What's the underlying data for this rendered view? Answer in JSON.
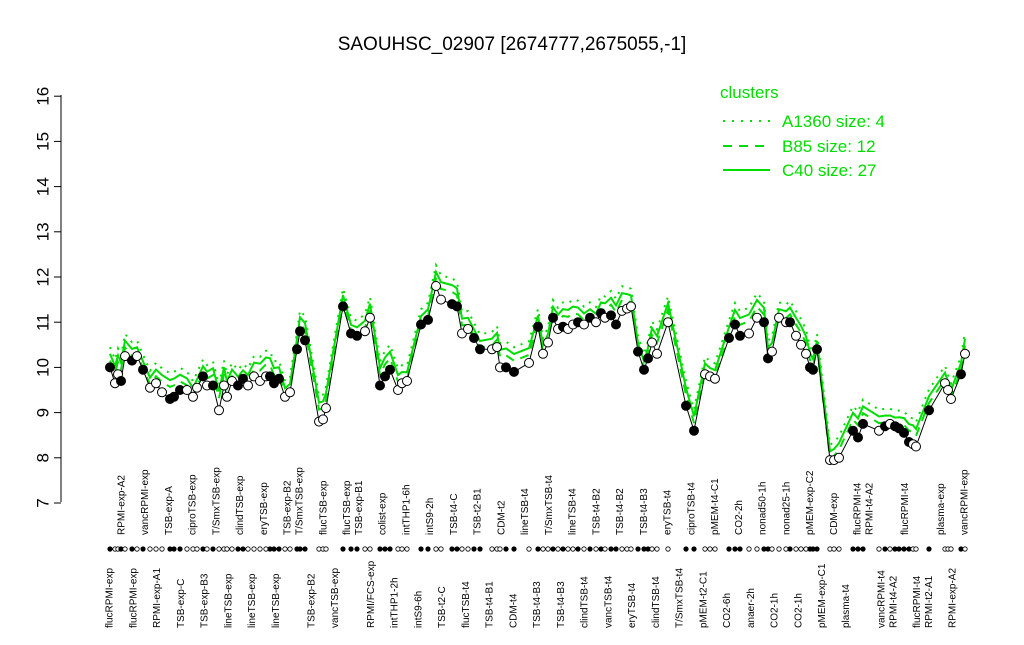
{
  "chart_data": {
    "type": "line",
    "title": "SAOUHSC_02907 [2674777,2675055,-1]",
    "xlabel": "",
    "ylabel": "",
    "ylim": [
      7,
      16
    ],
    "yticks": [
      "7",
      "8",
      "9",
      "10",
      "11",
      "12",
      "13",
      "14",
      "15",
      "16"
    ],
    "grid": false,
    "legend": {
      "title": "clusters",
      "placement": "top-right",
      "entries": [
        {
          "label": "A1360 size: 4",
          "style": "dotted"
        },
        {
          "label": "B85 size: 12",
          "style": "dashed"
        },
        {
          "label": "C40 size: 27",
          "style": "solid"
        }
      ]
    },
    "colors": {
      "cluster": "#00dd00",
      "profile": "#000000"
    },
    "x_labels": [
      {
        "text": "flucRPMI-exp",
        "row": "bottom"
      },
      {
        "text": "RPMI-exp-A2",
        "row": "top"
      },
      {
        "text": "flucRPMI-exp",
        "row": "bottom"
      },
      {
        "text": "vancRPMI-exp",
        "row": "top"
      },
      {
        "text": "RPMI-exp-A1",
        "row": "bottom"
      },
      {
        "text": "TSB-exp-A",
        "row": "top"
      },
      {
        "text": "TSB-exp-C",
        "row": "bottom"
      },
      {
        "text": "ciproTSB-exp",
        "row": "top"
      },
      {
        "text": "TSB-exp-B3",
        "row": "bottom"
      },
      {
        "text": "T/SmxTSB-exp",
        "row": "top"
      },
      {
        "text": "lineTSB-exp",
        "row": "bottom"
      },
      {
        "text": "clindTSB-exp",
        "row": "top"
      },
      {
        "text": "lineTSB-exp",
        "row": "bottom"
      },
      {
        "text": "eryTSB-exp",
        "row": "top"
      },
      {
        "text": "lineTSB-exp",
        "row": "bottom"
      },
      {
        "text": "TSB-exp-B2",
        "row": "top"
      },
      {
        "text": "T/SmxTSB-exp",
        "row": "top"
      },
      {
        "text": "TSB-exp-B2",
        "row": "bottom"
      },
      {
        "text": "flucTSB-exp",
        "row": "top"
      },
      {
        "text": "vancTSB-exp",
        "row": "bottom"
      },
      {
        "text": "flucTSB-exp",
        "row": "top"
      },
      {
        "text": "TSB-exp-B1",
        "row": "top"
      },
      {
        "text": "RPMI/FCS-exp",
        "row": "bottom"
      },
      {
        "text": "colist-exp",
        "row": "top"
      },
      {
        "text": "intTHP1-2h",
        "row": "bottom"
      },
      {
        "text": "intTHP1-6h",
        "row": "top"
      },
      {
        "text": "intS9-6h",
        "row": "bottom"
      },
      {
        "text": "intS9-2h",
        "row": "top"
      },
      {
        "text": "TSB-t2-C",
        "row": "bottom"
      },
      {
        "text": "TSB-t4-C",
        "row": "top"
      },
      {
        "text": "flucTSB-t4",
        "row": "bottom"
      },
      {
        "text": "TSB-t2-B1",
        "row": "top"
      },
      {
        "text": "TSB-t4-B1",
        "row": "bottom"
      },
      {
        "text": "CDM-t2",
        "row": "top"
      },
      {
        "text": "CDM-t4",
        "row": "bottom"
      },
      {
        "text": "lineTSB-t4",
        "row": "top"
      },
      {
        "text": "TSB-t4-B3",
        "row": "bottom"
      },
      {
        "text": "T/SmxTSB-t4",
        "row": "top"
      },
      {
        "text": "TSB-t4-B3",
        "row": "bottom"
      },
      {
        "text": "lineTSB-t4",
        "row": "top"
      },
      {
        "text": "clindTSB-t4",
        "row": "bottom"
      },
      {
        "text": "TSB-t4-B2",
        "row": "top"
      },
      {
        "text": "vancTSB-t4",
        "row": "bottom"
      },
      {
        "text": "TSB-t4-B2",
        "row": "top"
      },
      {
        "text": "eryTSB-t4",
        "row": "bottom"
      },
      {
        "text": "TSB-t4-B3",
        "row": "top"
      },
      {
        "text": "clindTSB-t4",
        "row": "bottom"
      },
      {
        "text": "eryTSB-t4",
        "row": "top"
      },
      {
        "text": "T/SmxTSB-t4",
        "row": "bottom"
      },
      {
        "text": "ciproTSB-t4",
        "row": "top"
      },
      {
        "text": "pMEM-t2-C1",
        "row": "bottom"
      },
      {
        "text": "pMEM-t4-C1",
        "row": "top"
      },
      {
        "text": "CO2-6h",
        "row": "bottom"
      },
      {
        "text": "CO2-2h",
        "row": "top"
      },
      {
        "text": "anaer-2h",
        "row": "bottom"
      },
      {
        "text": "nonad50-1h",
        "row": "top"
      },
      {
        "text": "CO2-1h",
        "row": "bottom"
      },
      {
        "text": "nonad25-1h",
        "row": "top"
      },
      {
        "text": "CO2-1h",
        "row": "bottom"
      },
      {
        "text": "pMEM-exp-C2",
        "row": "top"
      },
      {
        "text": "pMEM-exp-C1",
        "row": "bottom"
      },
      {
        "text": "CDM-exp",
        "row": "top"
      },
      {
        "text": "plasma-t4",
        "row": "bottom"
      },
      {
        "text": "flucRPMI-t4",
        "row": "top"
      },
      {
        "text": "RPMI-t4-A2",
        "row": "top"
      },
      {
        "text": "vancRPMI-t4",
        "row": "bottom"
      },
      {
        "text": "RPMI-t4-A2",
        "row": "bottom"
      },
      {
        "text": "flucRPMI-t4",
        "row": "top"
      },
      {
        "text": "flucRPMI-t4",
        "row": "bottom"
      },
      {
        "text": "RPMI-t2-A1",
        "row": "bottom"
      },
      {
        "text": "plasma-exp",
        "row": "top"
      },
      {
        "text": "RPMI-exp-A2",
        "row": "bottom"
      },
      {
        "text": "vancRPMI-exp",
        "row": "top"
      }
    ],
    "series": [
      {
        "points": [
          {
            "x": 110,
            "y": 10.0,
            "f": true
          },
          {
            "x": 115,
            "y": 9.65,
            "f": false
          },
          {
            "x": 118,
            "y": 9.85,
            "f": false
          },
          {
            "x": 121,
            "y": 9.7,
            "f": true
          },
          {
            "x": 125,
            "y": 10.25,
            "f": false
          },
          {
            "x": 132,
            "y": 10.15,
            "f": true
          },
          {
            "x": 137,
            "y": 10.25,
            "f": false
          },
          {
            "x": 143,
            "y": 9.95,
            "f": true
          },
          {
            "x": 150,
            "y": 9.55,
            "f": false
          },
          {
            "x": 156,
            "y": 9.65,
            "f": false
          },
          {
            "x": 162,
            "y": 9.45,
            "f": false
          },
          {
            "x": 170,
            "y": 9.3,
            "f": true
          },
          {
            "x": 174,
            "y": 9.35,
            "f": true
          },
          {
            "x": 180,
            "y": 9.5,
            "f": true
          },
          {
            "x": 187,
            "y": 9.5,
            "f": false
          },
          {
            "x": 193,
            "y": 9.35,
            "f": false
          },
          {
            "x": 197,
            "y": 9.55,
            "f": false
          },
          {
            "x": 203,
            "y": 9.8,
            "f": true
          },
          {
            "x": 207,
            "y": 9.6,
            "f": false
          },
          {
            "x": 213,
            "y": 9.6,
            "f": true
          },
          {
            "x": 219,
            "y": 9.05,
            "f": false
          },
          {
            "x": 224,
            "y": 9.6,
            "f": false
          },
          {
            "x": 227,
            "y": 9.35,
            "f": false
          },
          {
            "x": 232,
            "y": 9.7,
            "f": false
          },
          {
            "x": 238,
            "y": 9.6,
            "f": true
          },
          {
            "x": 243,
            "y": 9.75,
            "f": true
          },
          {
            "x": 248,
            "y": 9.6,
            "f": false
          },
          {
            "x": 254,
            "y": 9.8,
            "f": false
          },
          {
            "x": 260,
            "y": 9.7,
            "f": false
          },
          {
            "x": 266,
            "y": 9.8,
            "f": false
          },
          {
            "x": 270,
            "y": 9.8,
            "f": true
          },
          {
            "x": 274,
            "y": 9.65,
            "f": true
          },
          {
            "x": 279,
            "y": 9.75,
            "f": true
          },
          {
            "x": 285,
            "y": 9.35,
            "f": false
          },
          {
            "x": 290,
            "y": 9.45,
            "f": false
          },
          {
            "x": 297,
            "y": 10.4,
            "f": true
          },
          {
            "x": 300,
            "y": 10.8,
            "f": true
          },
          {
            "x": 305,
            "y": 10.6,
            "f": true
          },
          {
            "x": 319,
            "y": 8.8,
            "f": false
          },
          {
            "x": 323,
            "y": 8.85,
            "f": false
          },
          {
            "x": 326,
            "y": 9.1,
            "f": false
          },
          {
            "x": 343,
            "y": 11.35,
            "f": true
          },
          {
            "x": 351,
            "y": 10.75,
            "f": true
          },
          {
            "x": 357,
            "y": 10.7,
            "f": true
          },
          {
            "x": 365,
            "y": 10.8,
            "f": false
          },
          {
            "x": 370,
            "y": 11.1,
            "f": false
          },
          {
            "x": 380,
            "y": 9.6,
            "f": true
          },
          {
            "x": 385,
            "y": 9.8,
            "f": true
          },
          {
            "x": 390,
            "y": 9.95,
            "f": true
          },
          {
            "x": 398,
            "y": 9.5,
            "f": false
          },
          {
            "x": 402,
            "y": 9.65,
            "f": false
          },
          {
            "x": 407,
            "y": 9.7,
            "f": false
          },
          {
            "x": 421,
            "y": 10.95,
            "f": true
          },
          {
            "x": 428,
            "y": 11.05,
            "f": true
          },
          {
            "x": 436,
            "y": 11.8,
            "f": false
          },
          {
            "x": 441,
            "y": 11.5,
            "f": false
          },
          {
            "x": 452,
            "y": 11.4,
            "f": true
          },
          {
            "x": 457,
            "y": 11.35,
            "f": true
          },
          {
            "x": 462,
            "y": 10.75,
            "f": false
          },
          {
            "x": 468,
            "y": 10.85,
            "f": false
          },
          {
            "x": 474,
            "y": 10.65,
            "f": true
          },
          {
            "x": 480,
            "y": 10.4,
            "f": true
          },
          {
            "x": 492,
            "y": 10.4,
            "f": false
          },
          {
            "x": 497,
            "y": 10.45,
            "f": false
          },
          {
            "x": 500,
            "y": 10.0,
            "f": false
          },
          {
            "x": 506,
            "y": 10.0,
            "f": true
          },
          {
            "x": 514,
            "y": 9.9,
            "f": true
          },
          {
            "x": 529,
            "y": 10.1,
            "f": false
          },
          {
            "x": 538,
            "y": 10.9,
            "f": true
          },
          {
            "x": 543,
            "y": 10.3,
            "f": false
          },
          {
            "x": 548,
            "y": 10.55,
            "f": false
          },
          {
            "x": 553,
            "y": 11.1,
            "f": true
          },
          {
            "x": 558,
            "y": 10.85,
            "f": false
          },
          {
            "x": 563,
            "y": 10.9,
            "f": true
          },
          {
            "x": 568,
            "y": 10.85,
            "f": false
          },
          {
            "x": 573,
            "y": 10.95,
            "f": false
          },
          {
            "x": 578,
            "y": 11.0,
            "f": true
          },
          {
            "x": 584,
            "y": 10.95,
            "f": false
          },
          {
            "x": 590,
            "y": 11.1,
            "f": true
          },
          {
            "x": 596,
            "y": 11.0,
            "f": false
          },
          {
            "x": 601,
            "y": 11.2,
            "f": true
          },
          {
            "x": 605,
            "y": 11.1,
            "f": false
          },
          {
            "x": 611,
            "y": 11.15,
            "f": true
          },
          {
            "x": 616,
            "y": 10.95,
            "f": true
          },
          {
            "x": 622,
            "y": 11.25,
            "f": false
          },
          {
            "x": 627,
            "y": 11.3,
            "f": false
          },
          {
            "x": 631,
            "y": 11.35,
            "f": false
          },
          {
            "x": 638,
            "y": 10.35,
            "f": true
          },
          {
            "x": 644,
            "y": 9.95,
            "f": true
          },
          {
            "x": 648,
            "y": 10.2,
            "f": true
          },
          {
            "x": 652,
            "y": 10.55,
            "f": false
          },
          {
            "x": 657,
            "y": 10.3,
            "f": false
          },
          {
            "x": 668,
            "y": 11.0,
            "f": false
          },
          {
            "x": 686,
            "y": 9.15,
            "f": true
          },
          {
            "x": 694,
            "y": 8.6,
            "f": true
          },
          {
            "x": 705,
            "y": 9.85,
            "f": false
          },
          {
            "x": 710,
            "y": 9.8,
            "f": false
          },
          {
            "x": 715,
            "y": 9.75,
            "f": false
          },
          {
            "x": 729,
            "y": 10.65,
            "f": true
          },
          {
            "x": 735,
            "y": 10.95,
            "f": true
          },
          {
            "x": 740,
            "y": 10.7,
            "f": true
          },
          {
            "x": 749,
            "y": 10.75,
            "f": false
          },
          {
            "x": 757,
            "y": 11.1,
            "f": false
          },
          {
            "x": 764,
            "y": 11.0,
            "f": true
          },
          {
            "x": 768,
            "y": 10.2,
            "f": true
          },
          {
            "x": 772,
            "y": 10.35,
            "f": false
          },
          {
            "x": 779,
            "y": 11.1,
            "f": false
          },
          {
            "x": 786,
            "y": 11.0,
            "f": false
          },
          {
            "x": 790,
            "y": 11.0,
            "f": true
          },
          {
            "x": 796,
            "y": 10.7,
            "f": false
          },
          {
            "x": 801,
            "y": 10.5,
            "f": false
          },
          {
            "x": 806,
            "y": 10.3,
            "f": false
          },
          {
            "x": 810,
            "y": 10.0,
            "f": true
          },
          {
            "x": 813,
            "y": 9.95,
            "f": true
          },
          {
            "x": 817,
            "y": 10.4,
            "f": true
          },
          {
            "x": 830,
            "y": 7.95,
            "f": false
          },
          {
            "x": 834,
            "y": 7.95,
            "f": false
          },
          {
            "x": 839,
            "y": 8.0,
            "f": false
          },
          {
            "x": 853,
            "y": 8.6,
            "f": true
          },
          {
            "x": 858,
            "y": 8.45,
            "f": true
          },
          {
            "x": 863,
            "y": 8.75,
            "f": true
          },
          {
            "x": 879,
            "y": 8.6,
            "f": false
          },
          {
            "x": 885,
            "y": 8.7,
            "f": true
          },
          {
            "x": 890,
            "y": 8.75,
            "f": false
          },
          {
            "x": 895,
            "y": 8.7,
            "f": true
          },
          {
            "x": 899,
            "y": 8.65,
            "f": true
          },
          {
            "x": 904,
            "y": 8.55,
            "f": true
          },
          {
            "x": 909,
            "y": 8.35,
            "f": true
          },
          {
            "x": 913,
            "y": 8.3,
            "f": false
          },
          {
            "x": 916,
            "y": 8.25,
            "f": false
          },
          {
            "x": 929,
            "y": 9.05,
            "f": true
          },
          {
            "x": 945,
            "y": 9.65,
            "f": false
          },
          {
            "x": 948,
            "y": 9.5,
            "f": false
          },
          {
            "x": 951,
            "y": 9.3,
            "f": false
          },
          {
            "x": 961,
            "y": 9.85,
            "f": true
          },
          {
            "x": 965,
            "y": 10.3,
            "f": false
          }
        ]
      }
    ]
  }
}
